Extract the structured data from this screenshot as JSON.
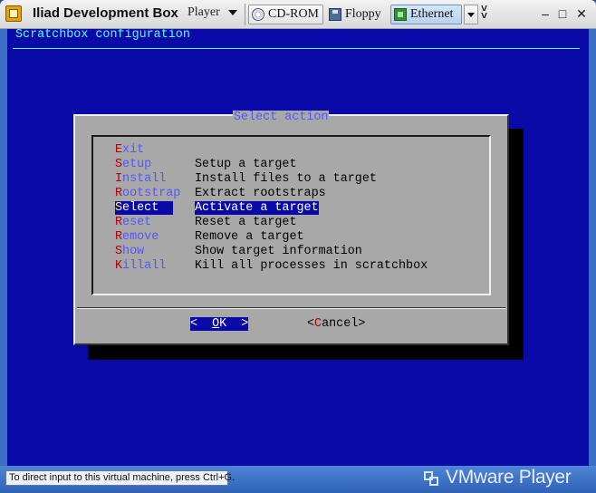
{
  "window": {
    "title": "Iliad Development Box",
    "player_menu": "Player",
    "devices": [
      {
        "label": "CD-ROM",
        "icon": "cdrom-icon"
      },
      {
        "label": "Floppy",
        "icon": "floppy-icon"
      },
      {
        "label": "Ethernet",
        "icon": "ethernet-icon"
      }
    ],
    "overflow_glyph": "»",
    "minimize_glyph": "–",
    "maximize_glyph": "□",
    "close_glyph": "✕"
  },
  "console": {
    "heading": "Scratchbox configuration",
    "dialog": {
      "title": "Select action",
      "items": [
        {
          "hot": "E",
          "rest": "xit",
          "desc": ""
        },
        {
          "hot": "S",
          "rest": "etup",
          "desc": "Setup a target"
        },
        {
          "hot": "I",
          "rest": "nstall",
          "desc": "Install files to a target"
        },
        {
          "hot": "R",
          "rest": "ootstrap",
          "desc": "Extract rootstraps"
        },
        {
          "hot": "S",
          "rest": "elect",
          "desc": "Activate a target"
        },
        {
          "hot": "R",
          "rest": "eset",
          "desc": "Reset a target"
        },
        {
          "hot": "R",
          "rest": "emove",
          "desc": "Remove a target"
        },
        {
          "hot": "S",
          "rest": "how",
          "desc": "Show target information"
        },
        {
          "hot": "K",
          "rest": "illall",
          "desc": "Kill all processes in scratchbox"
        }
      ],
      "selected_index": 4,
      "ok": {
        "left": "<  ",
        "hot": "O",
        "rest": "K  >"
      },
      "cancel": {
        "left": "<",
        "hot": "C",
        "rest": "ancel>"
      }
    }
  },
  "statusbar": {
    "hint": "To direct input to this virtual machine, press Ctrl+G.",
    "brand": "VMware Player"
  },
  "colors": {
    "console_bg": "#0a0aa8",
    "dialog_bg": "#a8a8a8",
    "heading": "#55ffff",
    "hotkey": "#b00000",
    "menu_key": "#5555ff"
  }
}
